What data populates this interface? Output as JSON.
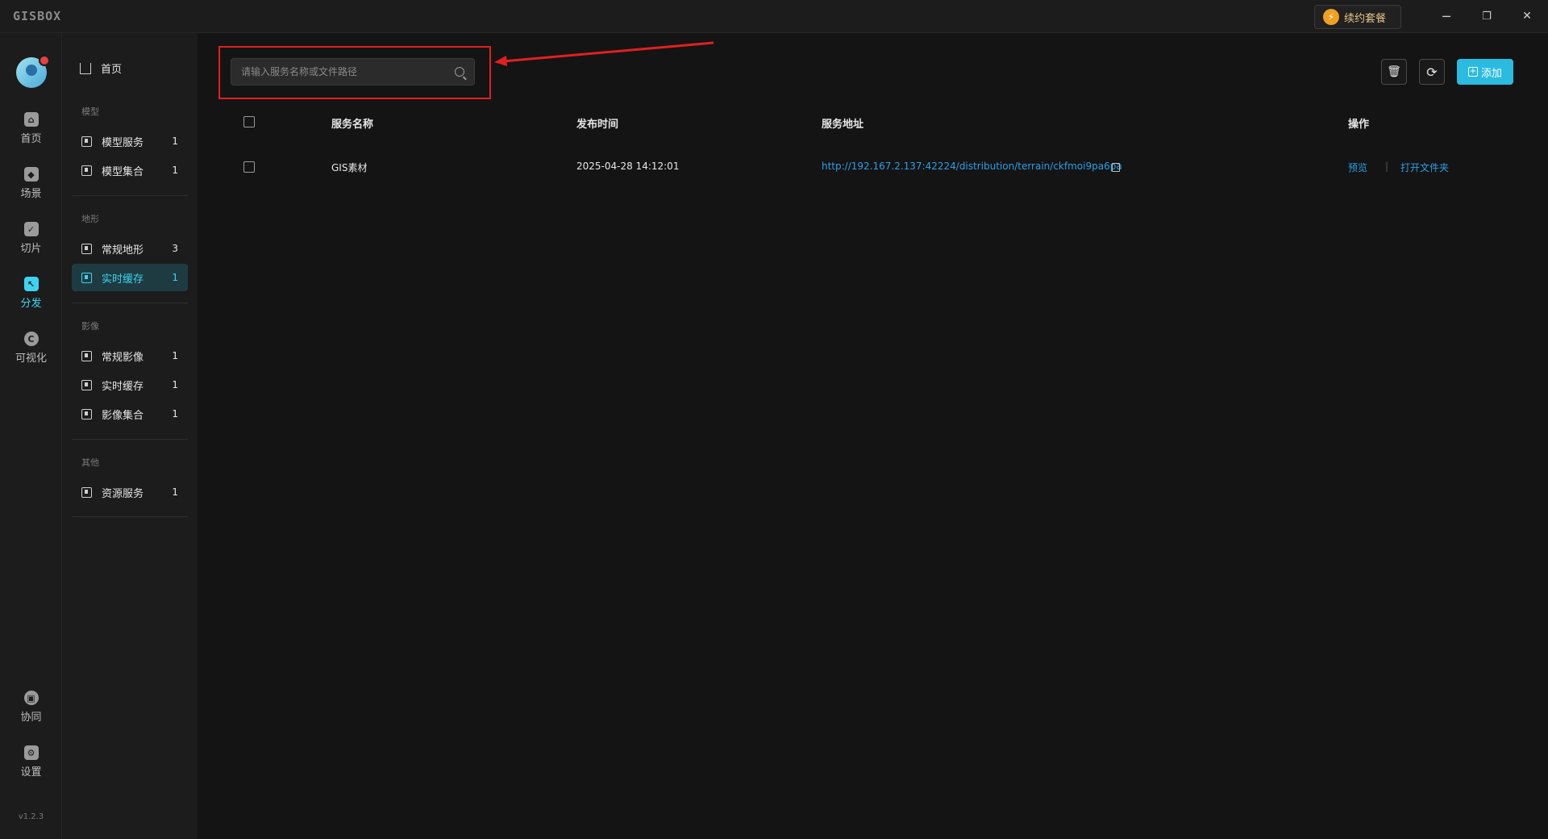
{
  "app": {
    "logo": "GISBOX"
  },
  "titlebar": {
    "plan_label": "续约套餐",
    "minimize": "─",
    "restore": "❐",
    "close": "✕"
  },
  "rail": {
    "items": [
      {
        "label": "首页",
        "icon": "home-icon",
        "glyph": "⌂"
      },
      {
        "label": "场景",
        "icon": "cube-icon",
        "glyph": "◆"
      },
      {
        "label": "切片",
        "icon": "slice-icon",
        "glyph": "✓"
      },
      {
        "label": "分发",
        "icon": "distribute-icon",
        "glyph": "↖"
      },
      {
        "label": "可视化",
        "icon": "visualize-icon",
        "glyph": "C"
      },
      {
        "label": "协同",
        "icon": "lock-icon",
        "glyph": "▣"
      },
      {
        "label": "设置",
        "icon": "settings-icon",
        "glyph": "⚙"
      }
    ],
    "version": "v1.2.3"
  },
  "sidebar": {
    "home": "首页",
    "sections": [
      {
        "title": "模型",
        "items": [
          {
            "label": "模型服务",
            "count": "1"
          },
          {
            "label": "模型集合",
            "count": "1"
          }
        ]
      },
      {
        "title": "地形",
        "items": [
          {
            "label": "常规地形",
            "count": "3"
          },
          {
            "label": "实时缓存",
            "count": "1"
          }
        ]
      },
      {
        "title": "影像",
        "items": [
          {
            "label": "常规影像",
            "count": "1"
          },
          {
            "label": "实时缓存",
            "count": "1"
          },
          {
            "label": "影像集合",
            "count": "1"
          }
        ]
      },
      {
        "title": "其他",
        "items": [
          {
            "label": "资源服务",
            "count": "1"
          }
        ]
      }
    ]
  },
  "search": {
    "placeholder": "请输入服务名称或文件路径",
    "value": ""
  },
  "toolbar": {
    "delete": "🗑",
    "refresh": "⟳",
    "add_label": "添加"
  },
  "table": {
    "headers": {
      "name": "服务名称",
      "time": "发布时间",
      "address": "服务地址",
      "actions": "操作"
    },
    "rows": [
      {
        "name": "GIS素材",
        "time": "2025-04-28 14:12:01",
        "address": "http://192.167.2.137:42224/distribution/terrain/ckfmoi9pa6pa",
        "preview": "预览",
        "open_folder": "打开文件夹",
        "sep": "|"
      }
    ]
  },
  "colors": {
    "accent": "#3dd3f0",
    "link": "#2b9fe6",
    "highlight": "#e02020"
  }
}
